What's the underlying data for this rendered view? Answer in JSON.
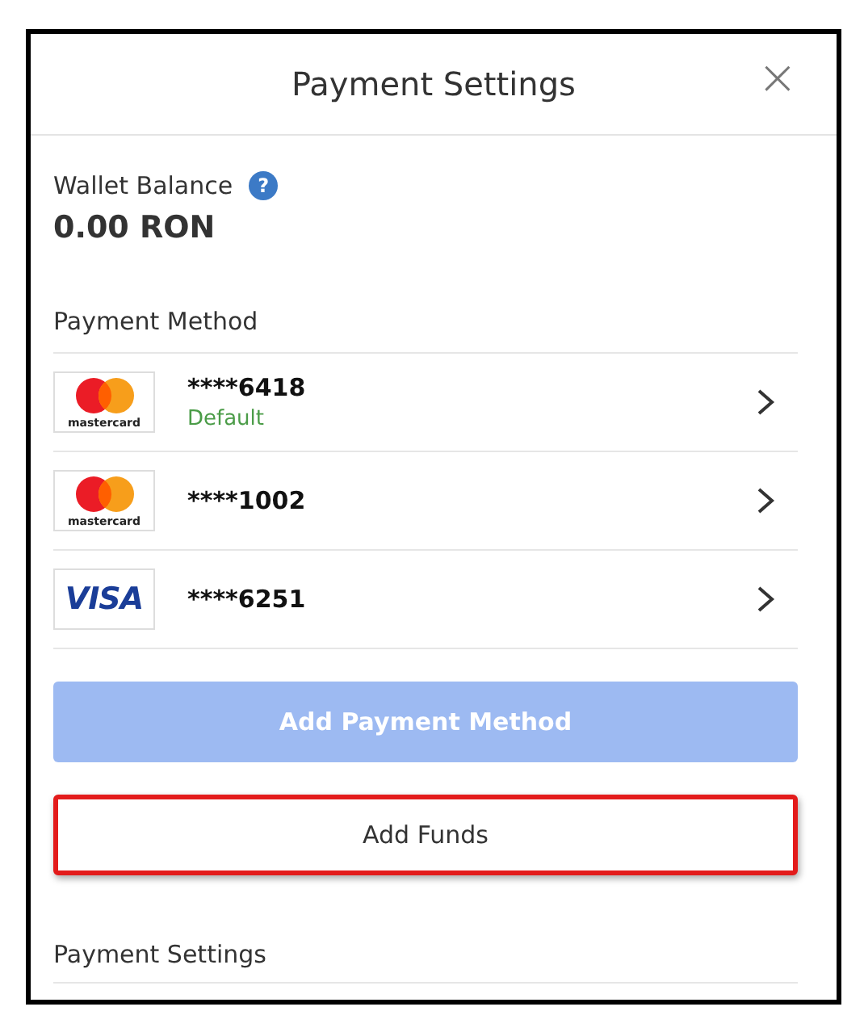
{
  "dialog": {
    "title": "Payment Settings",
    "close": "×"
  },
  "wallet": {
    "label": "Wallet Balance",
    "help": "?",
    "amount": "0.00 RON"
  },
  "payment_method": {
    "heading": "Payment Method",
    "cards": [
      {
        "kind": "mastercard",
        "logo_text": "mastercard",
        "number": "****6418",
        "note": "Default"
      },
      {
        "kind": "mastercard",
        "logo_text": "mastercard",
        "number": "****1002"
      },
      {
        "kind": "visa",
        "logo_text": "VISA",
        "number": "****6251"
      }
    ]
  },
  "buttons": [
    {
      "label": "Add Payment Method",
      "kind": "primary",
      "disabled": true,
      "highlighted": false
    },
    {
      "label": "Add Funds",
      "kind": "secondary",
      "disabled": false,
      "highlighted": true
    }
  ],
  "section": {
    "heading": "Payment Settings"
  }
}
